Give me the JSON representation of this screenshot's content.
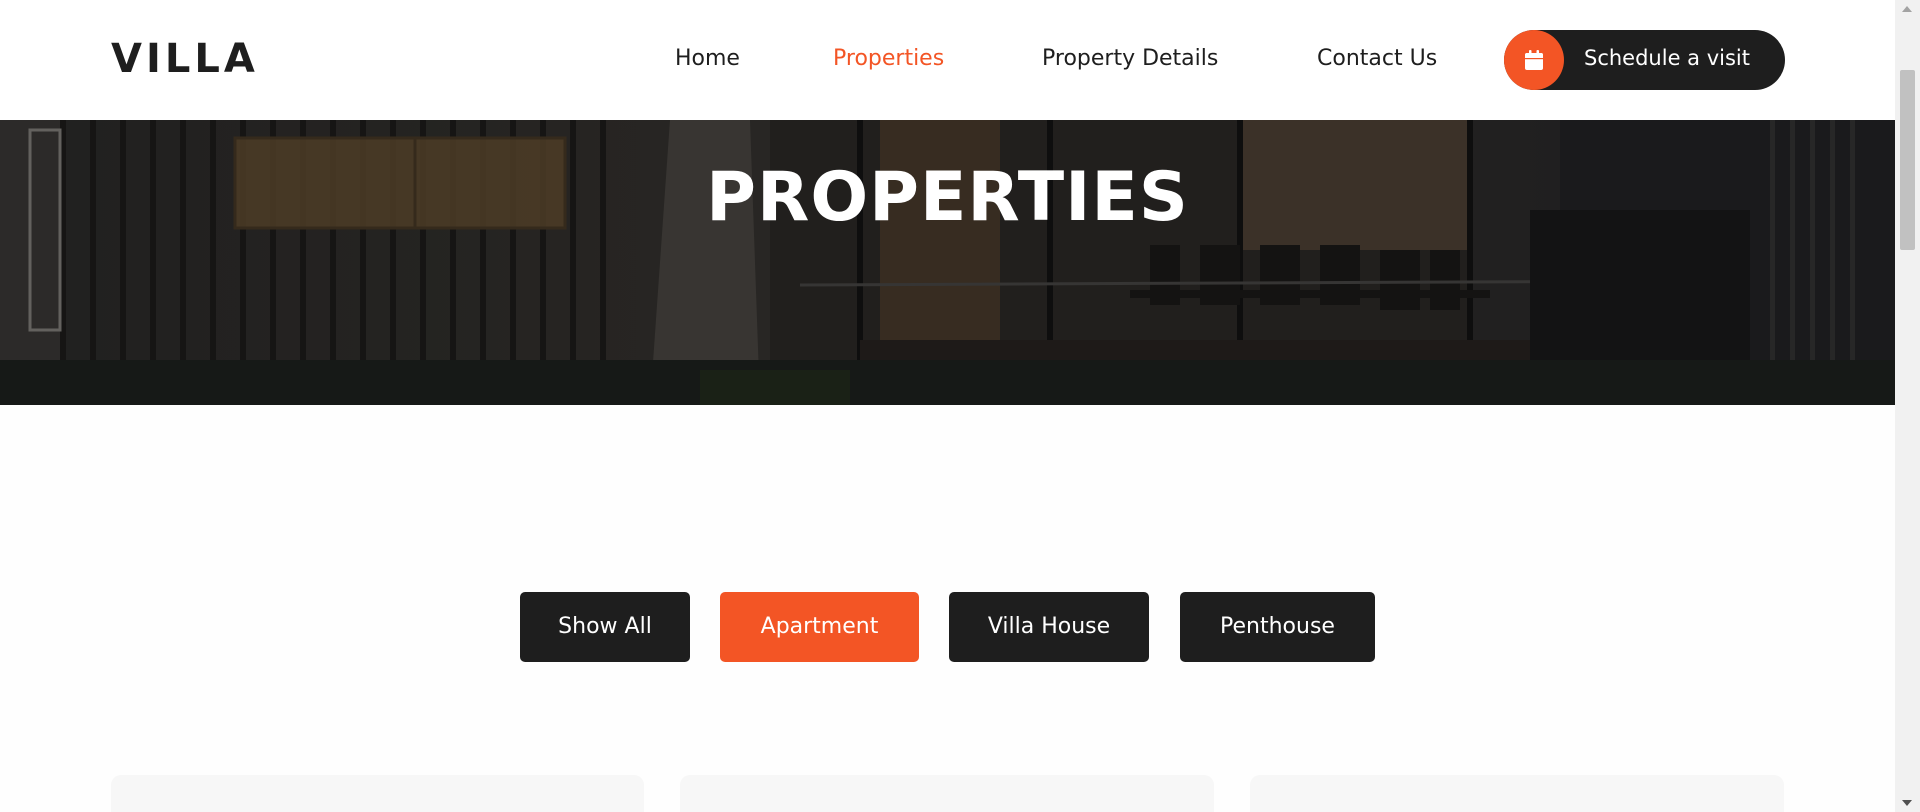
{
  "header": {
    "logo": "VILLA",
    "nav": [
      {
        "label": "Home",
        "active": false
      },
      {
        "label": "Properties",
        "active": true
      },
      {
        "label": "Property Details",
        "active": false
      },
      {
        "label": "Contact Us",
        "active": false
      }
    ],
    "cta_label": "Schedule a visit",
    "cta_icon": "calendar-icon"
  },
  "hero": {
    "title": "PROPERTIES"
  },
  "filters": [
    {
      "label": "Show All",
      "active": false
    },
    {
      "label": "Apartment",
      "active": true
    },
    {
      "label": "Villa House",
      "active": false
    },
    {
      "label": "Penthouse",
      "active": false
    }
  ],
  "colors": {
    "accent": "#f35525",
    "dark": "#1e1e1e",
    "white": "#ffffff"
  }
}
